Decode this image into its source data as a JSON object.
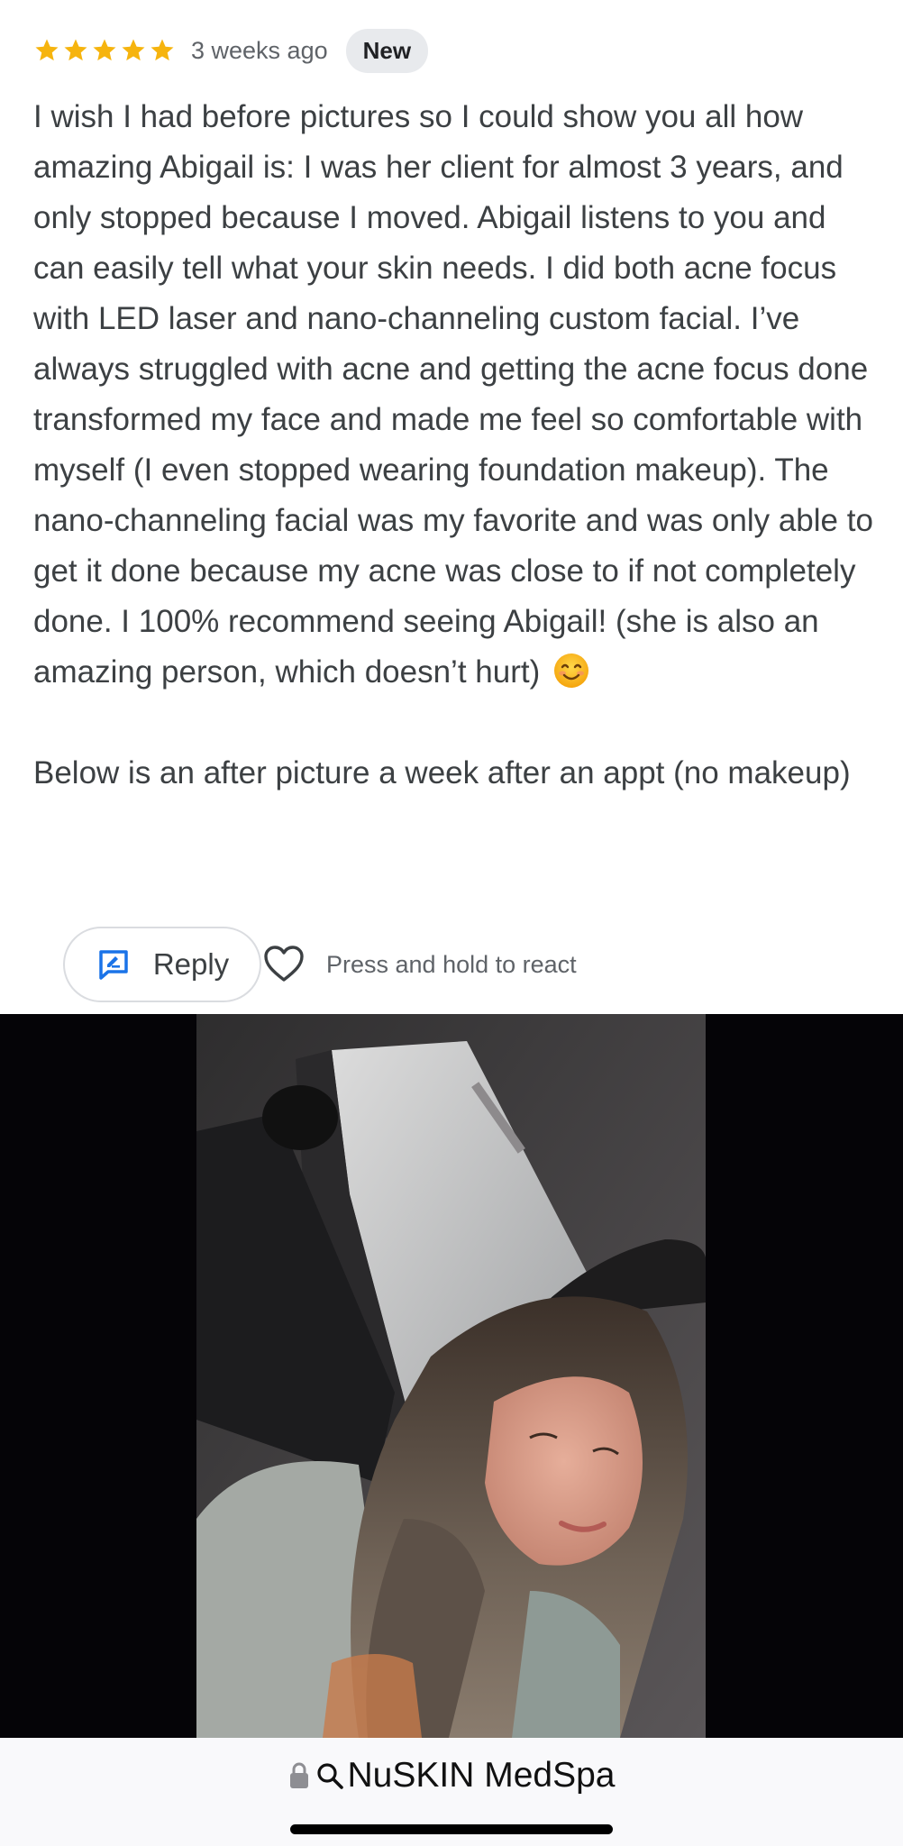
{
  "review": {
    "rating": 5,
    "rating_max": 5,
    "time_ago": "3 weeks ago",
    "badge": "New",
    "paragraphs": [
      "I wish I had before pictures so I could show you all how amazing Abigail is: I was her client for almost 3 years, and only stopped because I moved. Abigail listens to you and can easily tell what your skin needs. I did both acne focus with LED laser and nano-channeling custom facial. I’ve always struggled with acne and getting the acne focus done transformed my face and made me feel so comfortable with myself (I even stopped wearing foundation makeup). The nano-channeling facial was my favorite and was only able to get it done because my acne was close to if not completely done. I 100% recommend seeing Abigail! (she is also an amazing person, which doesn’t hurt)",
      "Below is an after picture a week after an appt (no makeup)"
    ],
    "emoji": "😊"
  },
  "actions": {
    "reply_label": "Reply",
    "react_hint": "Press and hold to react"
  },
  "bottom_bar": {
    "site_name": "NuSKIN MedSpa"
  },
  "icons": {
    "star": "star-icon",
    "reply": "reply-icon",
    "heart": "heart-icon",
    "lock": "lock-icon",
    "search": "search-icon"
  },
  "colors": {
    "star": "#F6B40E",
    "badge_bg": "#E8EAED",
    "reply_icon": "#1A73E8",
    "text": "#3C4043",
    "photo_backdrop": "#050407"
  }
}
